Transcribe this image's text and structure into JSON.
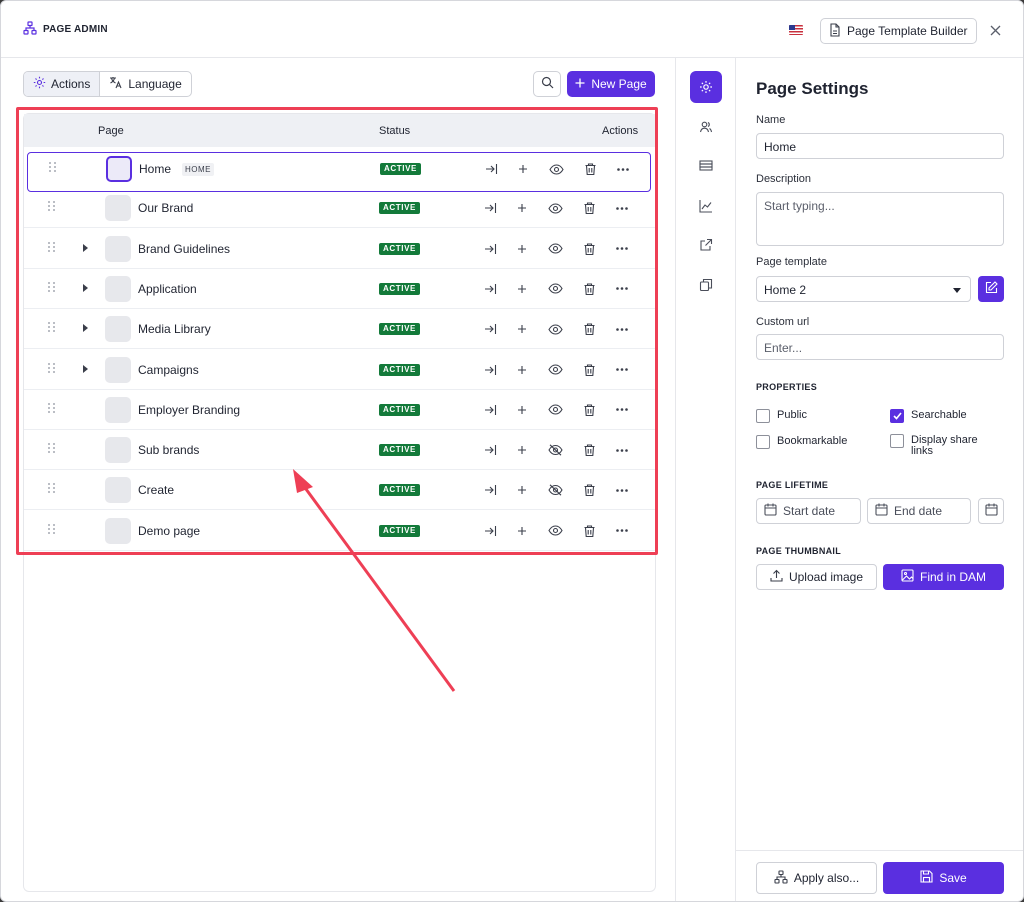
{
  "header": {
    "app_title": "PAGE ADMIN",
    "template_builder_label": "Page Template Builder"
  },
  "toolbar": {
    "actions_label": "Actions",
    "language_label": "Language",
    "new_page_label": "New Page"
  },
  "table": {
    "col_page": "Page",
    "col_status": "Status",
    "col_actions": "Actions",
    "rows": [
      {
        "name": "Home",
        "tag": "HOME",
        "status": "ACTIVE",
        "expandable": false,
        "visible": true,
        "selected": true
      },
      {
        "name": "Our Brand",
        "status": "ACTIVE",
        "expandable": false,
        "visible": true
      },
      {
        "name": "Brand Guidelines",
        "status": "ACTIVE",
        "expandable": true,
        "visible": true
      },
      {
        "name": "Application",
        "status": "ACTIVE",
        "expandable": true,
        "visible": true
      },
      {
        "name": "Media Library",
        "status": "ACTIVE",
        "expandable": true,
        "visible": true
      },
      {
        "name": "Campaigns",
        "status": "ACTIVE",
        "expandable": true,
        "visible": true
      },
      {
        "name": "Employer Branding",
        "status": "ACTIVE",
        "expandable": false,
        "visible": true
      },
      {
        "name": "Sub brands",
        "status": "ACTIVE",
        "expandable": false,
        "visible": false
      },
      {
        "name": "Create",
        "status": "ACTIVE",
        "expandable": false,
        "visible": false
      },
      {
        "name": "Demo page",
        "status": "ACTIVE",
        "expandable": false,
        "visible": true
      }
    ]
  },
  "settings": {
    "title": "Page Settings",
    "name_label": "Name",
    "name_value": "Home",
    "description_label": "Description",
    "description_placeholder": "Start typing...",
    "template_label": "Page template",
    "template_value": "Home 2",
    "custom_url_label": "Custom url",
    "custom_url_placeholder": "Enter...",
    "properties_heading": "PROPERTIES",
    "properties": [
      {
        "label": "Public",
        "checked": false
      },
      {
        "label": "Searchable",
        "checked": true
      },
      {
        "label": "Bookmarkable",
        "checked": false
      },
      {
        "label": "Display share links",
        "checked": false
      }
    ],
    "lifetime_heading": "PAGE LIFETIME",
    "start_date_placeholder": "Start date",
    "end_date_placeholder": "End date",
    "thumbnail_heading": "PAGE THUMBNAIL",
    "upload_label": "Upload image",
    "find_dam_label": "Find in DAM",
    "apply_label": "Apply also...",
    "save_label": "Save"
  },
  "colors": {
    "accent": "#5a2fe0",
    "status_active": "#137a3a",
    "annotation": "#ee3f55"
  }
}
